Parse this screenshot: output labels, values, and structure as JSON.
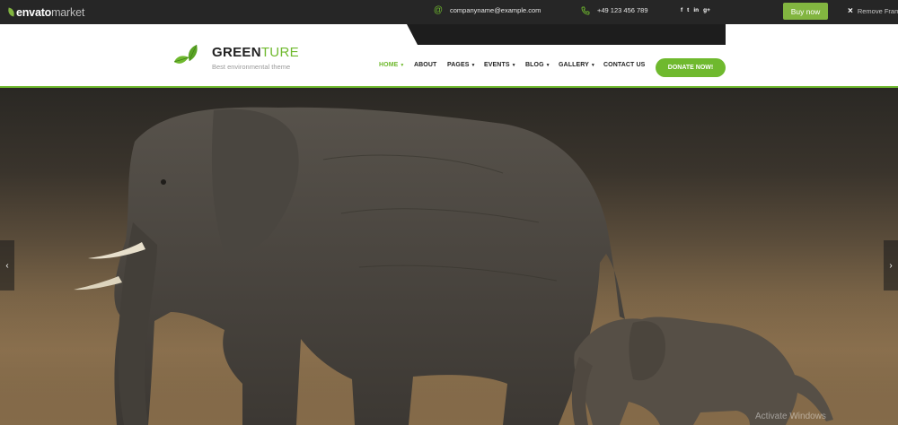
{
  "envato": {
    "brand": "envato",
    "sub": "market",
    "buy_label": "Buy now",
    "remove_label": "Remove Frame"
  },
  "contact": {
    "email": "companyname@example.com",
    "phone": "+49 123 456 789",
    "social": [
      "f",
      "t",
      "in",
      "g+"
    ]
  },
  "logo": {
    "title_bold": "GREEN",
    "title_light": "TURE",
    "tagline": "Best environmental theme"
  },
  "nav": {
    "items": [
      {
        "label": "HOME",
        "caret": true,
        "active": true
      },
      {
        "label": "ABOUT",
        "caret": false,
        "active": false
      },
      {
        "label": "PAGES",
        "caret": true,
        "active": false
      },
      {
        "label": "EVENTS",
        "caret": true,
        "active": false
      },
      {
        "label": "BLOG",
        "caret": true,
        "active": false
      },
      {
        "label": "GALLERY",
        "caret": true,
        "active": false
      },
      {
        "label": "CONTACT US",
        "caret": false,
        "active": false
      }
    ],
    "donate_label": "DONATE NOW!"
  },
  "hero": {
    "prev_symbol": "‹",
    "next_symbol": "›"
  },
  "watermark": "Activate Windows",
  "colors": {
    "accent": "#6fb92e",
    "envato_green": "#82b540",
    "frame_bar": "#262626",
    "contact_strip": "#1d1d1d"
  }
}
